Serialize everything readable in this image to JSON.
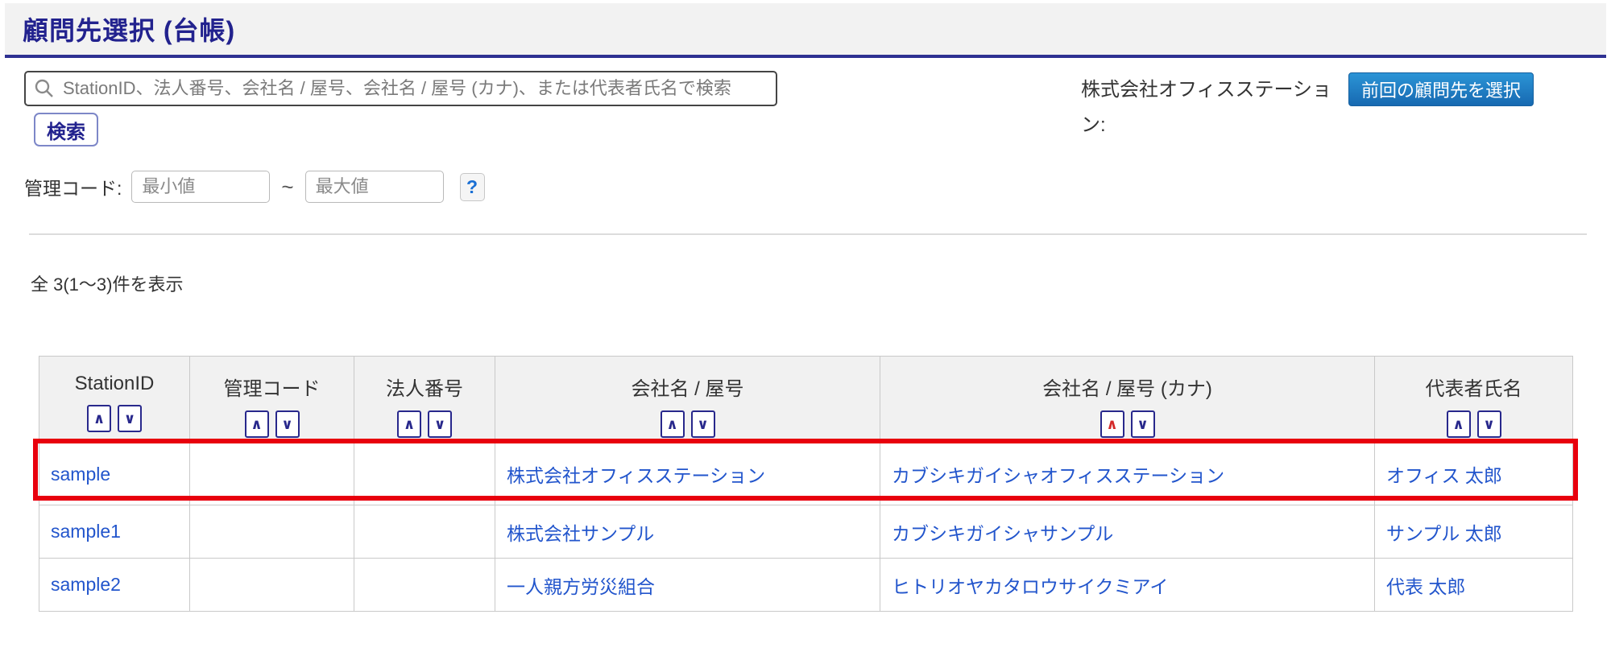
{
  "page": {
    "title": "顧問先選択 (台帳)"
  },
  "search": {
    "placeholder": "StationID、法人番号、会社名 / 屋号、会社名 / 屋号 (カナ)、または代表者氏名で検索",
    "button_label": "検索"
  },
  "previous_client": {
    "label": "株式会社オフィスステーション:",
    "button_label": "前回の顧問先を選択"
  },
  "kanri_code": {
    "label": "管理コード:",
    "min_placeholder": "最小値",
    "max_placeholder": "最大値",
    "separator": "~",
    "help_label": "?"
  },
  "result_count": "全 3(1〜3)件を表示",
  "table": {
    "columns": [
      {
        "label": "StationID"
      },
      {
        "label": "管理コード"
      },
      {
        "label": "法人番号"
      },
      {
        "label": "会社名 / 屋号"
      },
      {
        "label": "会社名 / 屋号 (カナ)"
      },
      {
        "label": "代表者氏名"
      }
    ],
    "sort_icons": {
      "asc": "∧",
      "desc": "∨"
    },
    "active_sort": {
      "column": "会社名 / 屋号 (カナ)",
      "direction": "asc"
    },
    "rows": [
      {
        "station_id": "sample",
        "kanri_code": "",
        "hojin_no": "",
        "company": "株式会社オフィスステーション",
        "company_kana": "カブシキガイシャオフィスステーション",
        "representative": "オフィス 太郎",
        "highlighted": true
      },
      {
        "station_id": "sample1",
        "kanri_code": "",
        "hojin_no": "",
        "company": "株式会社サンプル",
        "company_kana": "カブシキガイシャサンプル",
        "representative": "サンプル 太郎",
        "highlighted": false
      },
      {
        "station_id": "sample2",
        "kanri_code": "",
        "hojin_no": "",
        "company": "一人親方労災組合",
        "company_kana": "ヒトリオヤカタロウサイクミアイ",
        "representative": "代表 太郎",
        "highlighted": false
      }
    ]
  },
  "colors": {
    "accent_navy": "#2e3192",
    "title_navy": "#22228e",
    "link_blue": "#2255cc",
    "highlight_red": "#e8000d",
    "sort_active_red": "#d42a2a",
    "primary_button_blue": "#1d7fc4",
    "header_gray": "#f1f1f1"
  }
}
